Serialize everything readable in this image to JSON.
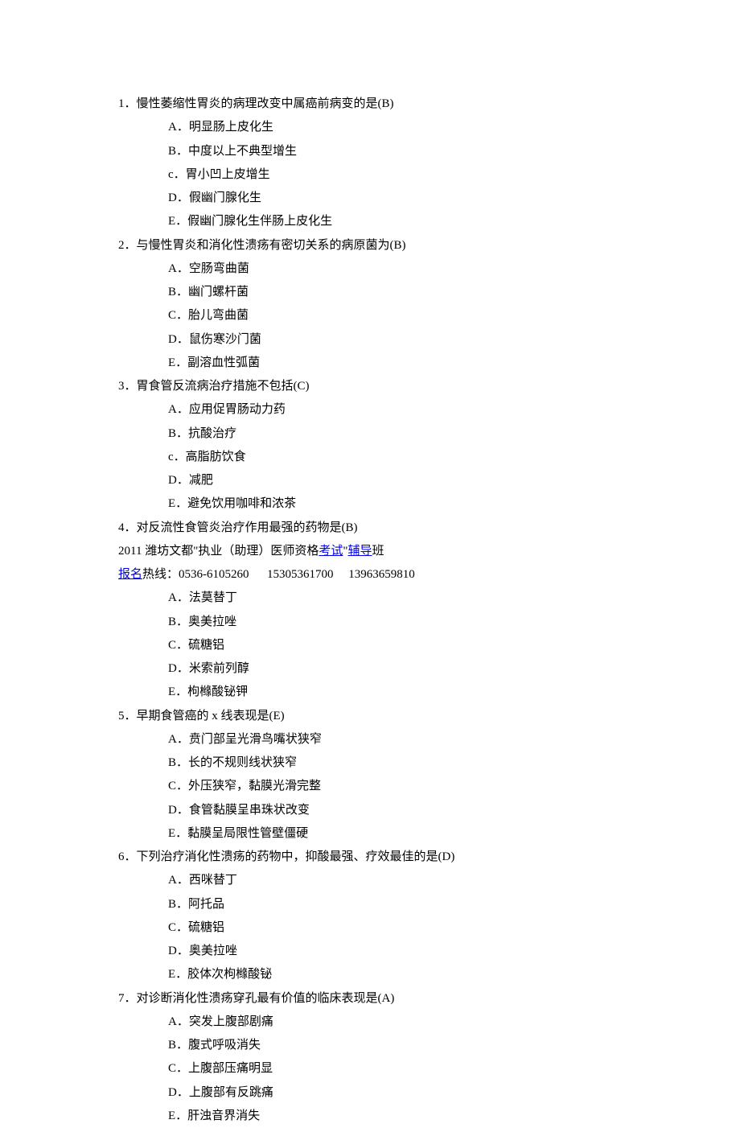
{
  "ad": {
    "line1_pre": "2011 潍坊文都\"执业（助理）医师资格",
    "link1": "考试",
    "line1_post": "\"",
    "link2": "辅导",
    "line1_tail": "班",
    "link3": "报名",
    "line2_post": "热线：0536-6105260      15305361700     13963659810"
  },
  "questions": [
    {
      "num": "1．",
      "stem": "慢性萎缩性胃炎的病理改变中属癌前病变的是(B)",
      "options": [
        {
          "letter": "A．",
          "text": "明显肠上皮化生"
        },
        {
          "letter": "B．",
          "text": "中度以上不典型增生"
        },
        {
          "letter": "c．",
          "text": "胃小凹上皮增生"
        },
        {
          "letter": "D．",
          "text": "假幽门腺化生"
        },
        {
          "letter": "E．",
          "text": "假幽门腺化生伴肠上皮化生"
        }
      ]
    },
    {
      "num": "2．",
      "stem": "与慢性胃炎和消化性溃疡有密切关系的病原菌为(B)",
      "options": [
        {
          "letter": "A．",
          "text": "空肠弯曲菌"
        },
        {
          "letter": "B．",
          "text": "幽门螺杆菌"
        },
        {
          "letter": "C．",
          "text": "胎儿弯曲菌"
        },
        {
          "letter": "D．",
          "text": "鼠伤寒沙门菌"
        },
        {
          "letter": "E．",
          "text": "副溶血性弧菌"
        }
      ]
    },
    {
      "num": "3．",
      "stem": "胃食管反流病治疗措施不包括(C)",
      "options": [
        {
          "letter": "A．",
          "text": "应用促胃肠动力药"
        },
        {
          "letter": "B．",
          "text": "抗酸治疗"
        },
        {
          "letter": "c．",
          "text": "高脂肪饮食"
        },
        {
          "letter": "D．",
          "text": "减肥"
        },
        {
          "letter": "E．",
          "text": "避免饮用咖啡和浓茶"
        }
      ]
    },
    {
      "num": "4．",
      "stem": "对反流性食管炎治疗作用最强的药物是(B)",
      "ad_after_stem": true,
      "options": [
        {
          "letter": "A．",
          "text": "法莫替丁"
        },
        {
          "letter": "B．",
          "text": "奥美拉唑"
        },
        {
          "letter": "C．",
          "text": "硫糖铝"
        },
        {
          "letter": "D．",
          "text": "米索前列醇"
        },
        {
          "letter": "E．",
          "text": "枸橼酸铋钾"
        }
      ]
    },
    {
      "num": "5．",
      "stem": "早期食管癌的 x 线表现是(E)",
      "options": [
        {
          "letter": "A．",
          "text": "贲门部呈光滑鸟嘴状狭窄"
        },
        {
          "letter": "B．",
          "text": "长的不规则线状狭窄"
        },
        {
          "letter": "C．",
          "text": "外压狭窄，黏膜光滑完整"
        },
        {
          "letter": "D．",
          "text": "食管黏膜呈串珠状改变"
        },
        {
          "letter": "E．",
          "text": "黏膜呈局限性管壁僵硬"
        }
      ]
    },
    {
      "num": "6．",
      "stem": "下列治疗消化性溃疡的药物中，抑酸最强、疗效最佳的是(D)",
      "options": [
        {
          "letter": "A．",
          "text": "西咪替丁"
        },
        {
          "letter": "B．",
          "text": "阿托品"
        },
        {
          "letter": "C．",
          "text": "硫糖铝"
        },
        {
          "letter": "D．",
          "text": "奥美拉唑"
        },
        {
          "letter": "E．",
          "text": "胶体次枸橼酸铋"
        }
      ]
    },
    {
      "num": "7．",
      "stem": "对诊断消化性溃疡穿孔最有价值的临床表现是(A)",
      "options": [
        {
          "letter": "A．",
          "text": "突发上腹部剧痛"
        },
        {
          "letter": "B．",
          "text": "腹式呼吸消失"
        },
        {
          "letter": "C．",
          "text": "上腹部压痛明显"
        },
        {
          "letter": "D．",
          "text": "上腹部有反跳痛"
        },
        {
          "letter": "E．",
          "text": "肝浊音界消失"
        }
      ]
    }
  ]
}
